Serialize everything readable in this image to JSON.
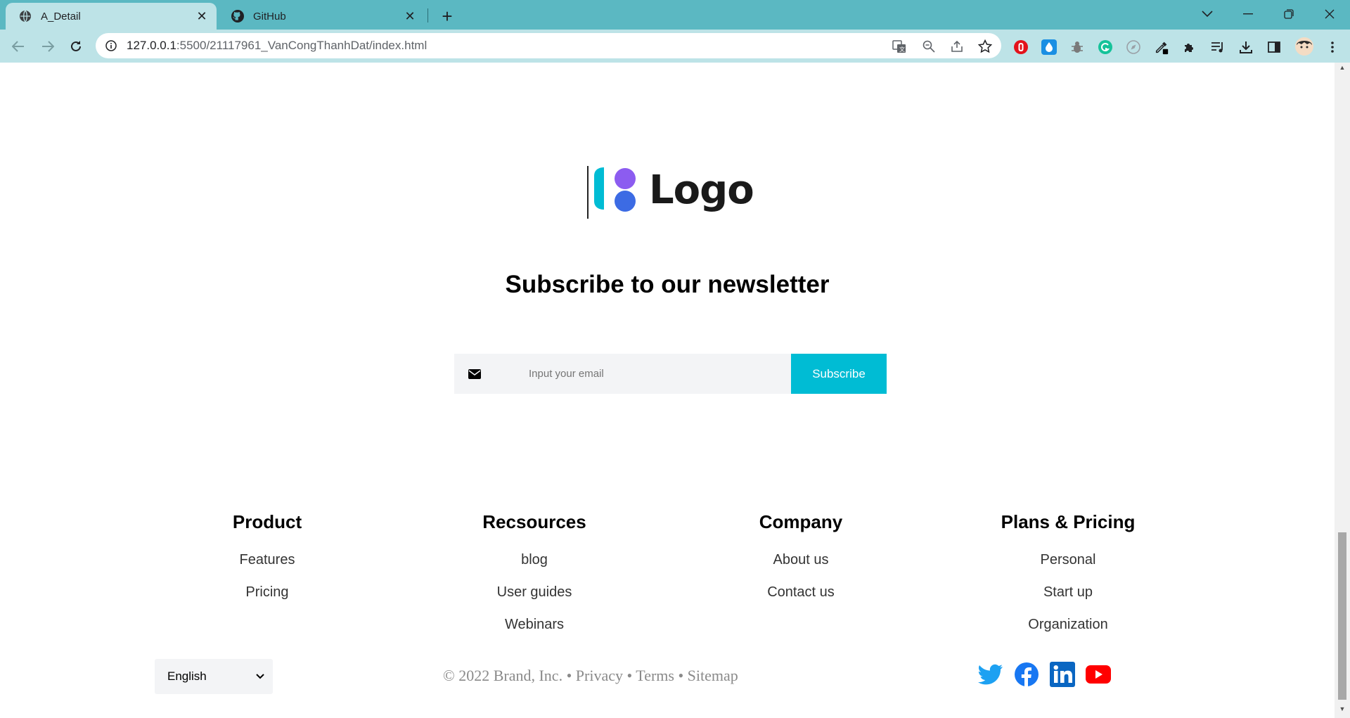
{
  "browser": {
    "tabs": [
      {
        "title": "A_Detail",
        "active": true
      },
      {
        "title": "GitHub",
        "active": false
      }
    ],
    "url_host": "127.0.0.1",
    "url_path": ":5500/21117961_VanCongThanhDat/index.html"
  },
  "page": {
    "logo_text": "Logo",
    "newsletter_title": "Subscribe to our newsletter",
    "email_placeholder": "Input your email",
    "subscribe_label": "Subscribe",
    "columns": [
      {
        "heading": "Product",
        "links": [
          "Features",
          "Pricing"
        ]
      },
      {
        "heading": "Recsources",
        "links": [
          "blog",
          "User guides",
          "Webinars"
        ]
      },
      {
        "heading": "Company",
        "links": [
          "About us",
          "Contact us"
        ]
      },
      {
        "heading": "Plans & Pricing",
        "links": [
          "Personal",
          "Start up",
          "Organization"
        ]
      }
    ],
    "language": "English",
    "copyright": {
      "text": "© 2022 Brand, Inc.",
      "sep1": "•",
      "privacy": "Privacy",
      "sep2": "•",
      "terms": "Terms",
      "sep3": "•",
      "sitemap": "Sitemap"
    },
    "social_icons": [
      "twitter-icon",
      "facebook-icon",
      "linkedin-icon",
      "youtube-icon"
    ]
  },
  "colors": {
    "accent": "#00bcd4",
    "tabbar": "#5bb8c2",
    "toolbar": "#bde3e7",
    "twitter": "#1da1f2",
    "facebook": "#1877f2",
    "linkedin": "#0a66c2",
    "youtube": "#ff0000"
  }
}
